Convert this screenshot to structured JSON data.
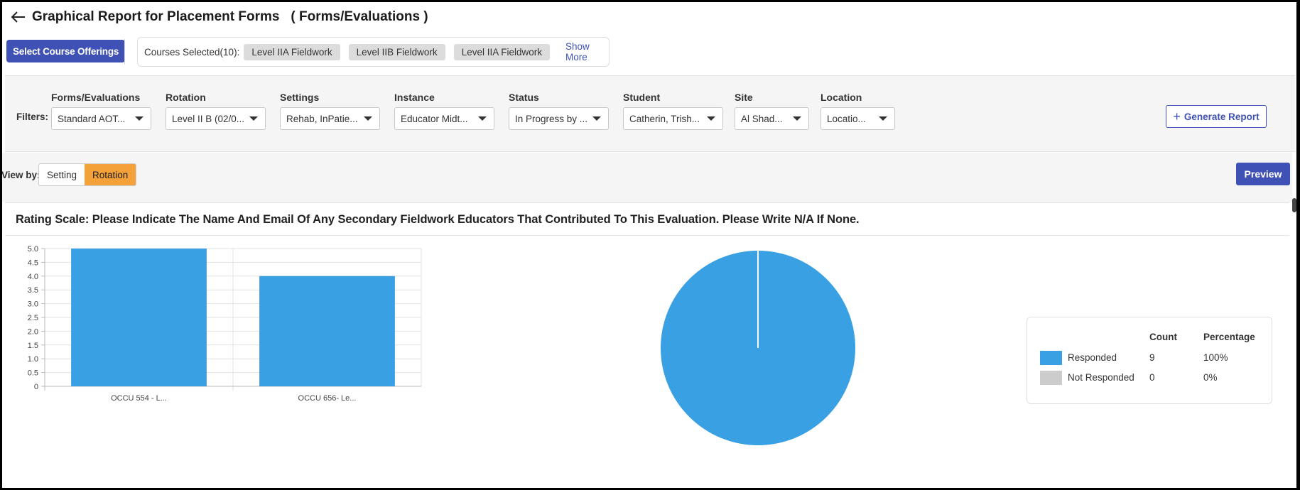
{
  "header": {
    "title": "Graphical Report for Placement Forms",
    "subtitle": "( Forms/Evaluations )"
  },
  "courses": {
    "select_button": "Select Course Offerings",
    "label": "Courses Selected(10):",
    "chips": [
      "Level IIA Fieldwork",
      "Level IIB Fieldwork",
      "Level IIA Fieldwork"
    ],
    "show_more": "Show More"
  },
  "filters": {
    "label": "Filters:",
    "items": [
      {
        "label": "Forms/Evaluations",
        "value": "Standard AOT..."
      },
      {
        "label": "Rotation",
        "value": "Level II B (02/0..."
      },
      {
        "label": "Settings",
        "value": "Rehab, InPatie..."
      },
      {
        "label": "Instance",
        "value": "Educator Midt..."
      },
      {
        "label": "Status",
        "value": "In Progress by ..."
      },
      {
        "label": "Student",
        "value": "Catherin, Trish..."
      },
      {
        "label": "Site",
        "value": "Al Shad..."
      },
      {
        "label": "Location",
        "value": "Locatio..."
      }
    ],
    "generate_button": "Generate Report"
  },
  "view": {
    "label": "View by:",
    "options": [
      "Setting",
      "Rotation"
    ],
    "active": "Rotation",
    "preview_button": "Preview"
  },
  "card": {
    "title": "Rating Scale: Please Indicate The Name And Email Of Any Secondary Fieldwork Educators That Contributed To This Evaluation. Please Write N/A If None."
  },
  "legend": {
    "headers": {
      "count": "Count",
      "percentage": "Percentage"
    },
    "rows": [
      {
        "label": "Responded",
        "count": "9",
        "percentage": "100%",
        "color": "#3aa0e4"
      },
      {
        "label": "Not Responded",
        "count": "0",
        "percentage": "0%",
        "color": "#cccccc"
      }
    ]
  },
  "colors": {
    "primary": "#3f51b5",
    "accent_orange": "#f4a13a",
    "bar_blue": "#3aa0e4"
  },
  "chart_data": [
    {
      "type": "bar",
      "categories": [
        "OCCU 554 - L...",
        "OCCU 656- Le..."
      ],
      "values": [
        5.0,
        4.0
      ],
      "ylim": [
        0,
        5
      ],
      "yticks": [
        "0",
        "0.5",
        "1.0",
        "1.5",
        "2.0",
        "2.5",
        "3.0",
        "3.5",
        "4.0",
        "4.5",
        "5.0"
      ],
      "grid": true,
      "color": "#3aa0e4"
    },
    {
      "type": "pie",
      "labels": [
        "Responded",
        "Not Responded"
      ],
      "values": [
        9,
        0
      ],
      "colors": [
        "#3aa0e4",
        "#cccccc"
      ]
    }
  ]
}
